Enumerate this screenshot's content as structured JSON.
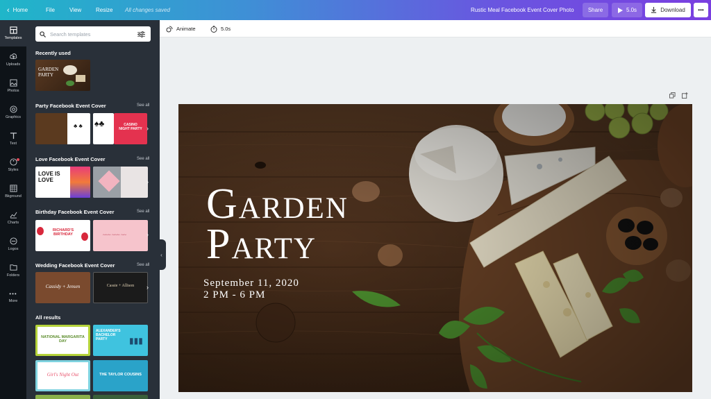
{
  "topbar": {
    "home": "Home",
    "file": "File",
    "view": "View",
    "resize": "Resize",
    "saved_status": "All changes saved",
    "doc_title": "Rustic Meal Facebook Event Cover Photo",
    "share": "Share",
    "play_duration": "5.0s",
    "download": "Download"
  },
  "rail": [
    {
      "label": "Templates",
      "icon": "templates-icon",
      "active": true
    },
    {
      "label": "Uploads",
      "icon": "upload-icon"
    },
    {
      "label": "Photos",
      "icon": "photo-icon"
    },
    {
      "label": "Graphics",
      "icon": "graphics-icon"
    },
    {
      "label": "Text",
      "icon": "text-icon"
    },
    {
      "label": "Styles",
      "icon": "styles-icon"
    },
    {
      "label": "Bkground",
      "icon": "background-icon"
    },
    {
      "label": "Charts",
      "icon": "chart-icon"
    },
    {
      "label": "Logos",
      "icon": "logo-icon"
    },
    {
      "label": "Folders",
      "icon": "folder-icon"
    },
    {
      "label": "More",
      "icon": "more-icon"
    }
  ],
  "panel": {
    "search_placeholder": "Search templates",
    "recently_used": "Recently used",
    "sections": [
      {
        "title": "Party Facebook Event Cover",
        "see_all": "See all"
      },
      {
        "title": "Love Facebook Event Cover",
        "see_all": "See all"
      },
      {
        "title": "Birthday Facebook Event Cover",
        "see_all": "See all"
      },
      {
        "title": "Wedding Facebook Event Cover",
        "see_all": "See all"
      }
    ],
    "all_results": "All results",
    "thumb_text": {
      "recent": "GARDEN PARTY",
      "casino": "CASINO NIGHT PARTY",
      "love": "LOVE IS LOVE",
      "richard": "RICHARD'S BIRTHDAY",
      "wedding1": "Cassidy + Jensen",
      "wedding2": "Cassie + Allison",
      "national": "NATIONAL MARGARITA DAY",
      "alexander": "ALEXANDER'S BACHELOR PARTY",
      "girls": "Girl's Night Out",
      "taylor": "THE TAYLOR COUSINS"
    }
  },
  "editbar": {
    "animate": "Animate",
    "duration": "5.0s"
  },
  "design": {
    "title_line1": "Garden",
    "title_line2": "Party",
    "date": "September 11, 2020",
    "time": "2 PM - 6 PM"
  }
}
